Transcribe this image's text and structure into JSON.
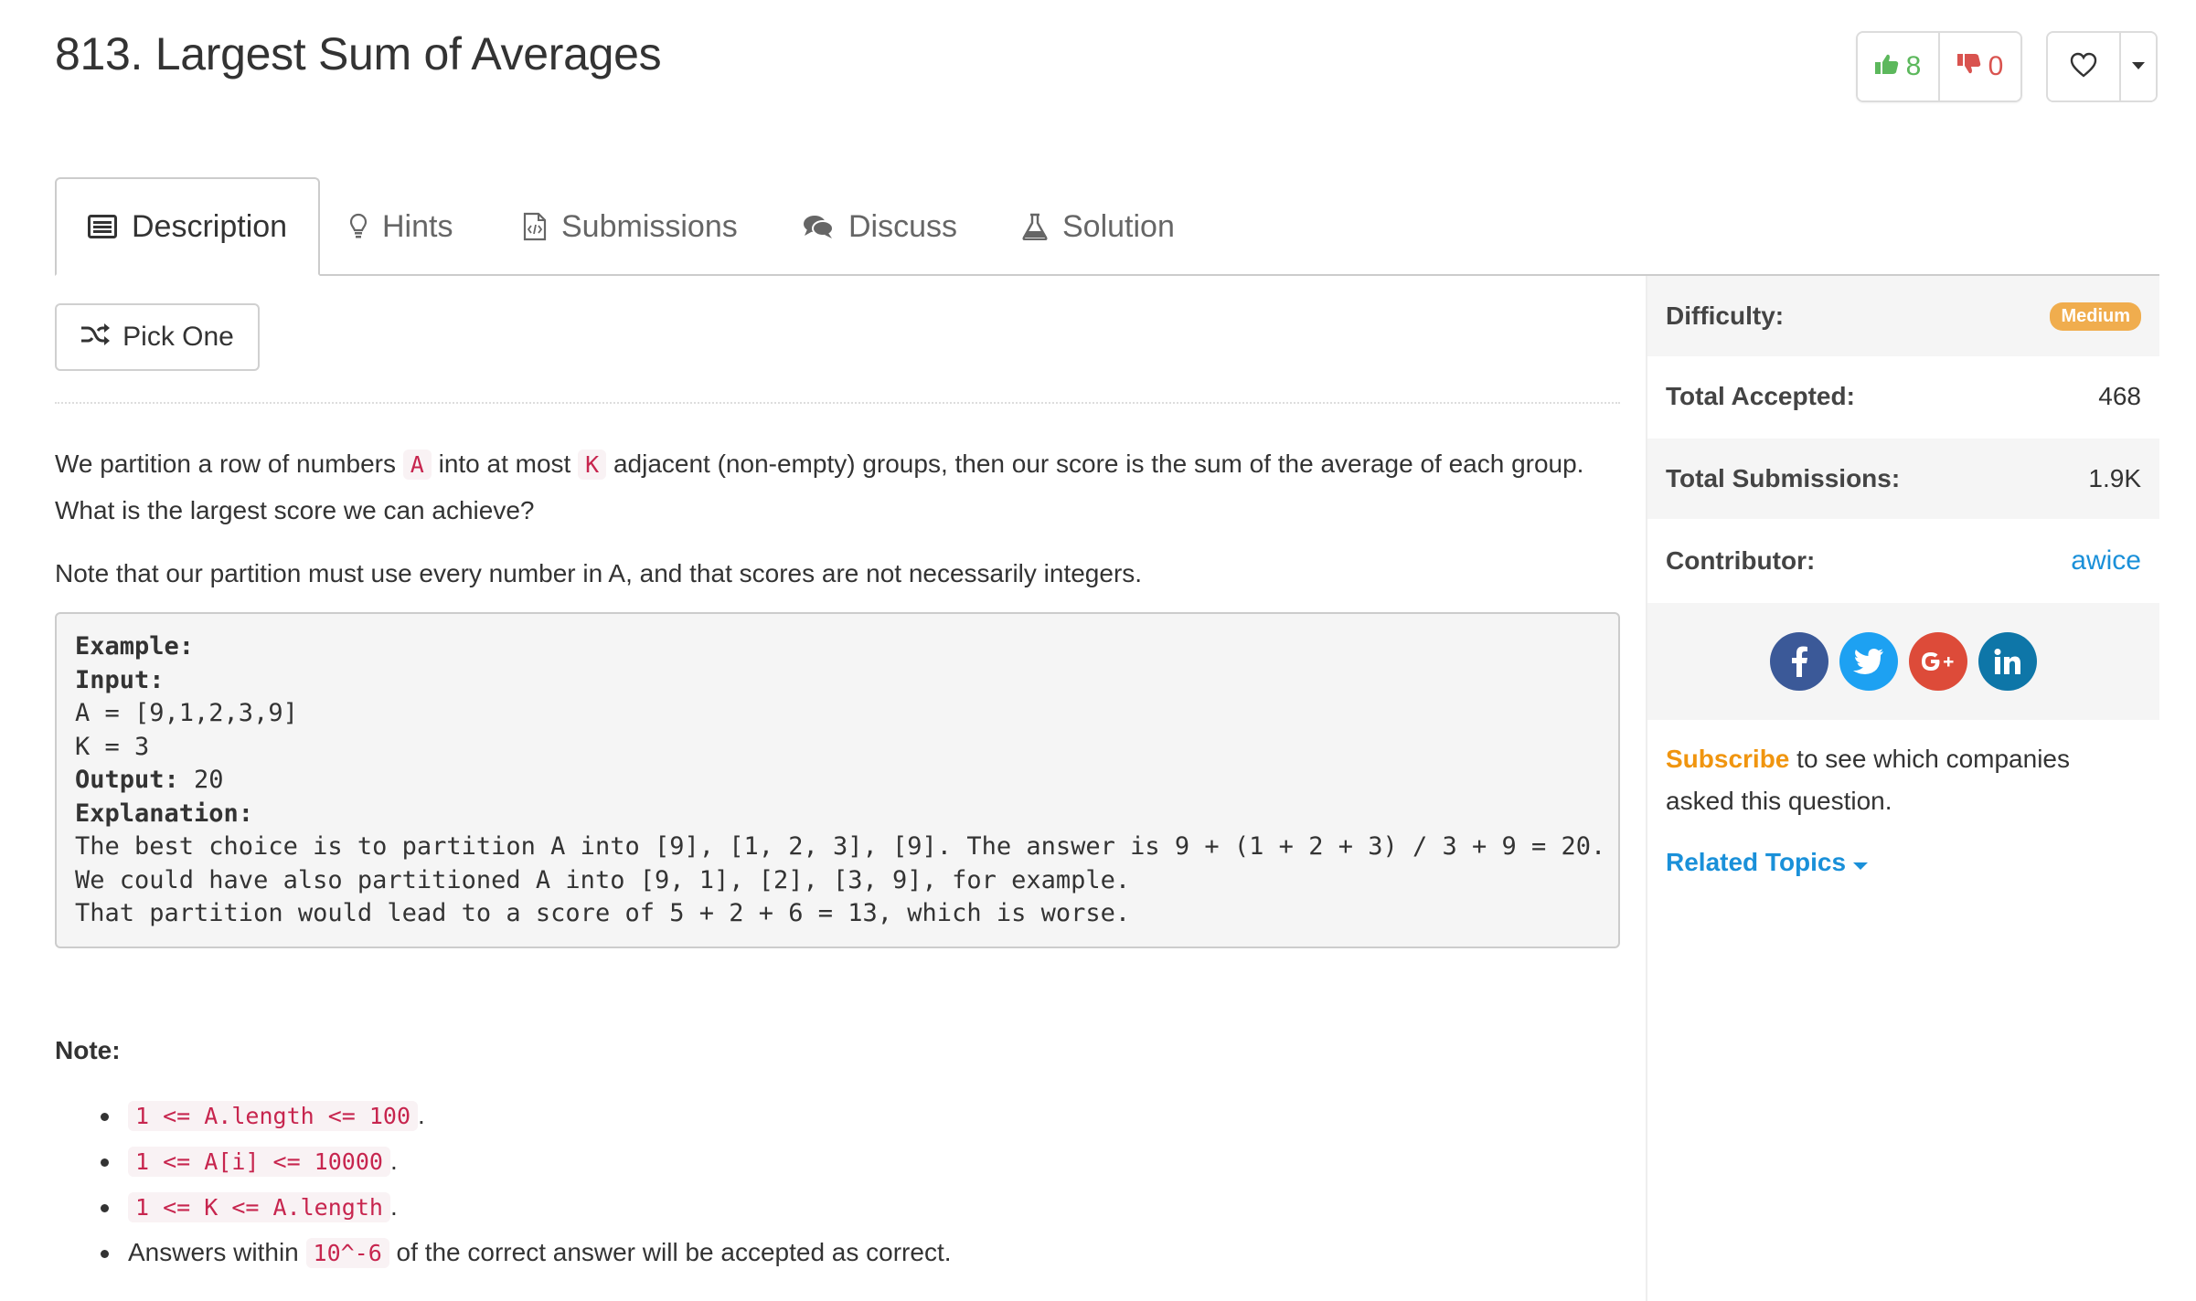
{
  "problem": {
    "title": "813. Largest Sum of Averages"
  },
  "votes": {
    "likes": "8",
    "dislikes": "0",
    "colors": {
      "like": "#5cb85c",
      "dislike": "#d9534f"
    }
  },
  "tabs": [
    {
      "label": "Description",
      "icon": "description-icon",
      "active": true
    },
    {
      "label": "Hints",
      "icon": "lightbulb-icon",
      "active": false
    },
    {
      "label": "Submissions",
      "icon": "file-code-icon",
      "active": false
    },
    {
      "label": "Discuss",
      "icon": "comments-icon",
      "active": false
    },
    {
      "label": "Solution",
      "icon": "flask-icon",
      "active": false
    }
  ],
  "pick_one": {
    "label": "Pick One",
    "icon": "shuffle-icon"
  },
  "description": {
    "p1_before": "We partition a row of numbers ",
    "p1_code1": "A",
    "p1_mid": " into at most ",
    "p1_code2": "K",
    "p1_after": " adjacent (non-empty) groups, then our score is the sum of the average of each group.",
    "p1_line2": "What is the largest score we can achieve?",
    "p2": "Note that our partition must use every number in A, and that scores are not necessarily integers."
  },
  "example": {
    "heading": "Example:",
    "input_label": "Input:",
    "input_line1": "A = [9,1,2,3,9]",
    "input_line2": "K = 3",
    "output_label": "Output:",
    "output_value": " 20",
    "explanation_label": "Explanation:",
    "explanation_lines": [
      "The best choice is to partition A into [9], [1, 2, 3], [9]. The answer is 9 + (1 + 2 + 3) / 3 + 9 = 20.",
      "We could have also partitioned A into [9, 1], [2], [3, 9], for example.",
      "That partition would lead to a score of 5 + 2 + 6 = 13, which is worse."
    ]
  },
  "note": {
    "heading": "Note:",
    "items": [
      {
        "code": "1 <= A.length <= 100",
        "after": "."
      },
      {
        "code": "1 <= A[i] <= 10000",
        "after": "."
      },
      {
        "code": "1 <= K <= A.length",
        "after": "."
      },
      {
        "before": "Answers within ",
        "code": "10^-6",
        "after": " of the correct answer will be accepted as correct."
      }
    ]
  },
  "sidebar": {
    "difficulty_label": "Difficulty:",
    "difficulty_value": "Medium",
    "difficulty_color": "#f0ad4e",
    "accepted_label": "Total Accepted:",
    "accepted_value": "468",
    "submissions_label": "Total Submissions:",
    "submissions_value": "1.9K",
    "contributor_label": "Contributor:",
    "contributor_value": "awice",
    "social": [
      {
        "name": "facebook-icon",
        "glyph": "f",
        "color": "#3b5998"
      },
      {
        "name": "twitter-icon",
        "glyph": "t",
        "color": "#1da1f2"
      },
      {
        "name": "google-plus-icon",
        "glyph": "G+",
        "color": "#dd4b39"
      },
      {
        "name": "linkedin-icon",
        "glyph": "in",
        "color": "#0e76a8"
      }
    ],
    "subscribe_link": "Subscribe",
    "subscribe_rest": " to see which companies asked this question.",
    "related_topics": "Related Topics"
  }
}
